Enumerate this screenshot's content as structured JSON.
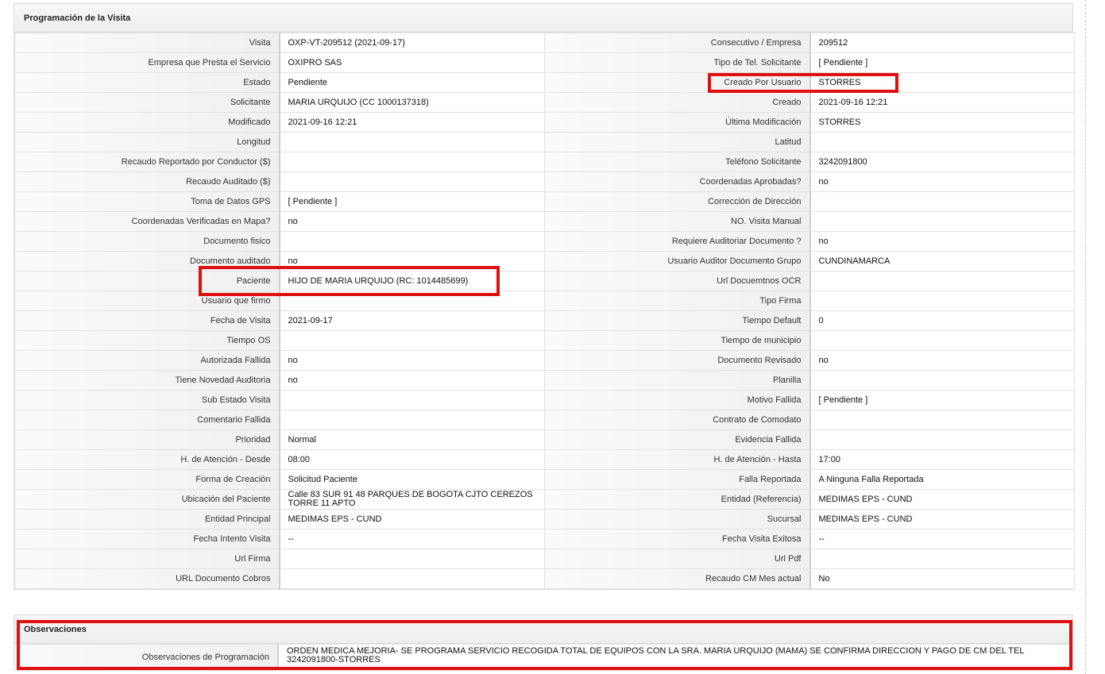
{
  "section_title": "Programación de la Visita",
  "rows": [
    {
      "l1": "Visita",
      "v1": "OXP-VT-209512 (2021-09-17)",
      "l2": "Consecutivo / Empresa",
      "v2": "209512"
    },
    {
      "l1": "Empresa que Presta el Servicio",
      "v1": "OXIPRO SAS",
      "l2": "Tipo de Tel. Solicitante",
      "v2": "[ Pendiente ]"
    },
    {
      "l1": "Estado",
      "v1": "Pendiente",
      "l2": "Creado Por Usuario",
      "v2": "STORRES"
    },
    {
      "l1": "Solicitante",
      "v1": "MARIA URQUIJO (CC 1000137318)",
      "l2": "Creado",
      "v2": "2021-09-16 12:21"
    },
    {
      "l1": "Modificado",
      "v1": "2021-09-16 12:21",
      "l2": "Última Modificación",
      "v2": " STORRES"
    },
    {
      "l1": "Longitud",
      "v1": "",
      "l2": "Latitud",
      "v2": ""
    },
    {
      "l1": "Recaudo Reportado por Conductor ($)",
      "v1": "",
      "l2": "Teléfono Solicitante",
      "v2": "3242091800"
    },
    {
      "l1": "Recaudo Auditado ($)",
      "v1": "",
      "l2": "Coordenadas Aprobadas?",
      "v2": " no"
    },
    {
      "l1": "Toma de Datos GPS",
      "v1": "[ Pendiente ]",
      "l2": "Corrección de Dirección",
      "v2": ""
    },
    {
      "l1": "Coordenadas Verificadas en Mapa?",
      "v1": " no",
      "l2": "NO. Visita Manual",
      "v2": ""
    },
    {
      "l1": "Documento fisico",
      "v1": "",
      "l2": "Requiere Auditoriar Documento ?",
      "v2": " no"
    },
    {
      "l1": "Documento auditado",
      "v1": " no",
      "l2": "Usuario Auditor Documento Grupo",
      "v2": "CUNDINAMARCA"
    },
    {
      "l1": "Paciente",
      "v1": "HIJO DE MARIA URQUIJO (RC: 1014485699)",
      "l2": "Url Docuemtnos OCR",
      "v2": ""
    },
    {
      "l1": "Usuario que firmo",
      "v1": "",
      "l2": "Tipo Firma",
      "v2": ""
    },
    {
      "l1": "Fecha de Visita",
      "v1": " 2021-09-17",
      "l2": "Tiempo Default",
      "v2": "0"
    },
    {
      "l1": "Tiempo OS",
      "v1": "",
      "l2": "Tiempo de municipio",
      "v2": ""
    },
    {
      "l1": "Autorizada Fallida",
      "v1": " no",
      "l2": "Documento Revisado",
      "v2": " no"
    },
    {
      "l1": "Tiene Novedad Auditoria",
      "v1": " no",
      "l2": "Planilla",
      "v2": ""
    },
    {
      "l1": "Sub Estado Visita",
      "v1": "",
      "l2": "Motivo Fallida",
      "v2": "[ Pendiente ]"
    },
    {
      "l1": "Comentario Fallida",
      "v1": "",
      "l2": "Contrato de Comodato",
      "v2": ""
    },
    {
      "l1": "Prioridad",
      "v1": "Normal",
      "l2": "Evidencia Fallida",
      "v2": ""
    },
    {
      "l1": "H. de Atención - Desde",
      "v1": "08:00",
      "l2": "H. de Atención - Hasta",
      "v2": "17:00"
    },
    {
      "l1": "Forma de Creación",
      "v1": "Solicitud Paciente",
      "l2": "Falla Reportada",
      "v2": "A Ninguna Falla Reportada"
    },
    {
      "l1": "Ubicación del Paciente",
      "v1": "Calle 83 SUR 91 48 PARQUES DE BOGOTA CJTO CEREZOS TORRE 11 APTO",
      "l2": "Entidad (Referencia)",
      "v2": "MEDIMAS EPS - CUND"
    },
    {
      "l1": "Entidad Principal",
      "v1": "MEDIMAS EPS - CUND",
      "l2": "Sucursal",
      "v2": "MEDIMAS EPS - CUND"
    },
    {
      "l1": "Fecha Intento Visita",
      "v1": " --",
      "l2": "Fecha Visita Exitosa",
      "v2": " --"
    },
    {
      "l1": "Url Firma",
      "v1": "",
      "l2": "Url Pdf",
      "v2": ""
    },
    {
      "l1": "URL Documento Cobros",
      "v1": "",
      "l2": "Recaudo CM Mes actual",
      "v2": "No"
    }
  ],
  "observaciones": {
    "title": "Observaciones",
    "label": "Observaciones de Programación",
    "value": "  ORDEN MEDICA MEJORIA- SE PROGRAMA SERVICIO RECOGIDA TOTAL DE EQUIPOS CON LA SRA. MARIA URQUIJO (MAMA) SE CONFIRMA DIRECCION Y PAGO DE CM DEL TEL 3242091800-STORRES"
  },
  "highlight_color": "#e01010"
}
